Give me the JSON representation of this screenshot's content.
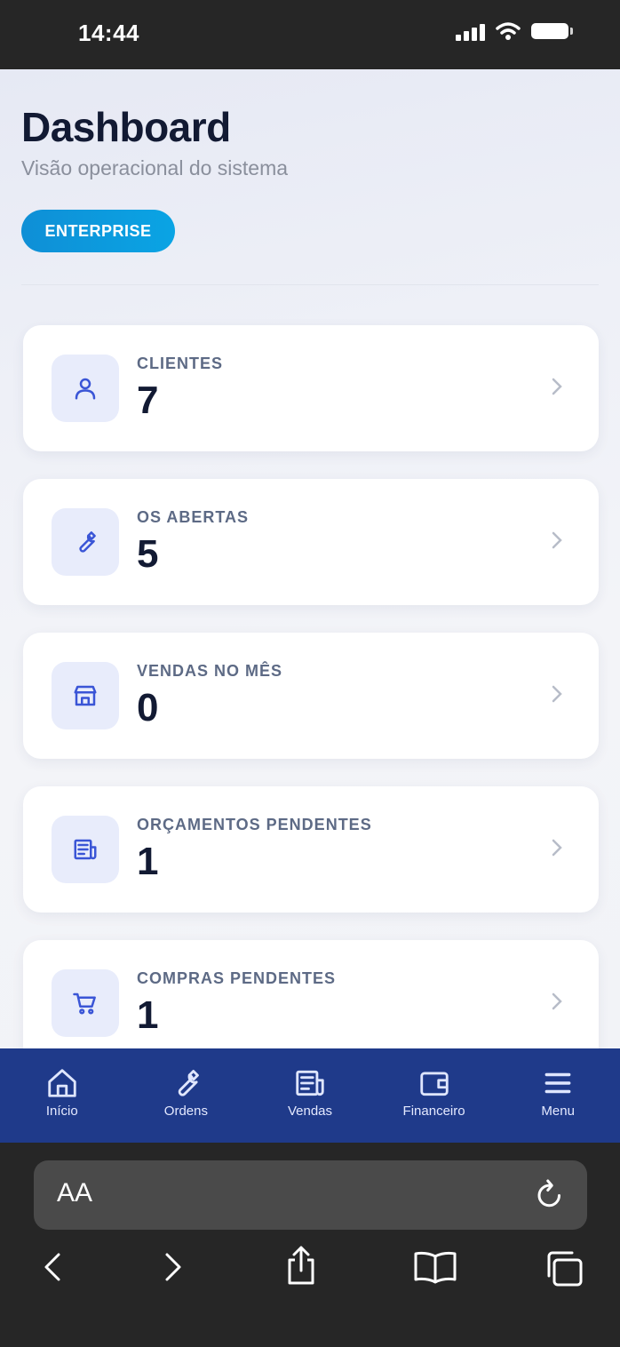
{
  "status_bar": {
    "time": "14:44"
  },
  "header": {
    "title": "Dashboard",
    "subtitle": "Visão operacional do sistema",
    "plan_badge": "ENTERPRISE"
  },
  "cards": [
    {
      "label": "CLIENTES",
      "value": "7",
      "icon": "user-icon"
    },
    {
      "label": "OS ABERTAS",
      "value": "5",
      "icon": "wrench-icon"
    },
    {
      "label": "VENDAS NO MÊS",
      "value": "0",
      "icon": "store-icon"
    },
    {
      "label": "ORÇAMENTOS PENDENTES",
      "value": "1",
      "icon": "receipt-icon"
    },
    {
      "label": "COMPRAS PENDENTES",
      "value": "1",
      "icon": "cart-icon"
    }
  ],
  "bottom_nav": [
    {
      "label": "Início",
      "icon": "home-icon"
    },
    {
      "label": "Ordens",
      "icon": "wrench-icon"
    },
    {
      "label": "Vendas",
      "icon": "receipt-icon"
    },
    {
      "label": "Financeiro",
      "icon": "wallet-icon"
    },
    {
      "label": "Menu",
      "icon": "menu-icon"
    }
  ],
  "browser": {
    "text_size_label": "AA"
  },
  "colors": {
    "accent": "#1f3a8a",
    "badge": "#0a9ce0",
    "icon_bg": "#e8ecfb",
    "icon_stroke": "#3a55d6"
  }
}
